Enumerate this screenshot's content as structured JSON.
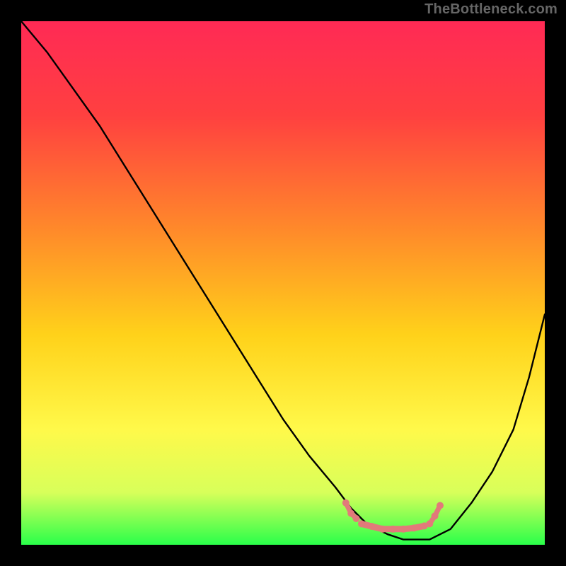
{
  "watermark": "TheBottleneck.com",
  "chart_data": {
    "type": "line",
    "title": "",
    "xlabel": "",
    "ylabel": "",
    "xlim": [
      0,
      100
    ],
    "ylim": [
      0,
      100
    ],
    "grid": false,
    "legend": false,
    "gradient_stops": [
      {
        "offset": 0,
        "color": "#ff2a55"
      },
      {
        "offset": 18,
        "color": "#ff4040"
      },
      {
        "offset": 40,
        "color": "#ff8a2a"
      },
      {
        "offset": 60,
        "color": "#ffd21a"
      },
      {
        "offset": 78,
        "color": "#fff94a"
      },
      {
        "offset": 90,
        "color": "#d8ff5a"
      },
      {
        "offset": 100,
        "color": "#2aff4a"
      }
    ],
    "series": [
      {
        "name": "bottleneck-curve",
        "stroke": "#000000",
        "x": [
          0,
          5,
          10,
          15,
          20,
          25,
          30,
          35,
          40,
          45,
          50,
          55,
          60,
          63,
          66,
          70,
          73,
          78,
          82,
          86,
          90,
          94,
          97,
          100
        ],
        "y": [
          100,
          94,
          87,
          80,
          72,
          64,
          56,
          48,
          40,
          32,
          24,
          17,
          11,
          7,
          4,
          2,
          1,
          1,
          3,
          8,
          14,
          22,
          32,
          44
        ]
      },
      {
        "name": "optimal-band-marker",
        "stroke": "#e27a7a",
        "segments": [
          {
            "x": [
              62,
              63,
              64
            ],
            "y": [
              8,
              6,
              5
            ]
          },
          {
            "x": [
              65,
              67,
              69,
              71,
              73,
              75,
              77
            ],
            "y": [
              4,
              3.5,
              3,
              3,
              3,
              3.2,
              3.6
            ]
          },
          {
            "x": [
              78,
              79,
              80
            ],
            "y": [
              4,
              5.5,
              7.5
            ]
          }
        ]
      }
    ]
  }
}
